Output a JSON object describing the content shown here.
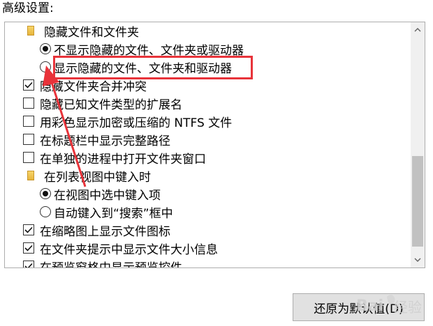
{
  "section": {
    "title": "高级设置:"
  },
  "items": [
    {
      "kind": "folder",
      "indent": 0,
      "label": "隐藏文件和文件夹"
    },
    {
      "kind": "radio",
      "indent": 1,
      "checked": true,
      "label": "不显示隐藏的文件、文件夹或驱动器"
    },
    {
      "kind": "radio",
      "indent": 1,
      "checked": false,
      "label": "显示隐藏的文件、文件夹和驱动器"
    },
    {
      "kind": "checkbox",
      "indent": 0,
      "checked": true,
      "label": "隐藏文件夹合并冲突"
    },
    {
      "kind": "checkbox",
      "indent": 0,
      "checked": false,
      "label": "隐藏已知文件类型的扩展名"
    },
    {
      "kind": "checkbox",
      "indent": 0,
      "checked": false,
      "label": "用彩色显示加密或压缩的 NTFS 文件"
    },
    {
      "kind": "checkbox",
      "indent": 0,
      "checked": false,
      "label": "在标题栏中显示完整路径"
    },
    {
      "kind": "checkbox",
      "indent": 0,
      "checked": false,
      "label": "在单独的进程中打开文件夹窗口"
    },
    {
      "kind": "folder",
      "indent": 0,
      "label": "在列表视图中键入时"
    },
    {
      "kind": "radio",
      "indent": 1,
      "checked": true,
      "label": "在视图中选中键入项"
    },
    {
      "kind": "radio",
      "indent": 1,
      "checked": false,
      "label": "自动键入到“搜索”框中"
    },
    {
      "kind": "checkbox",
      "indent": 0,
      "checked": true,
      "label": "在缩略图上显示文件图标"
    },
    {
      "kind": "checkbox",
      "indent": 0,
      "checked": true,
      "label": "在文件夹提示中显示文件大小信息"
    },
    {
      "kind": "checkbox",
      "indent": 0,
      "checked": true,
      "label": "在预览窗格中显示预览控件"
    }
  ],
  "restore_button": {
    "label": "还原为默认值(D)"
  },
  "watermark": {
    "text": "Bai经验"
  },
  "colors": {
    "annotation": "#e8333a",
    "scroll_thumb": "#c1c1c1"
  }
}
